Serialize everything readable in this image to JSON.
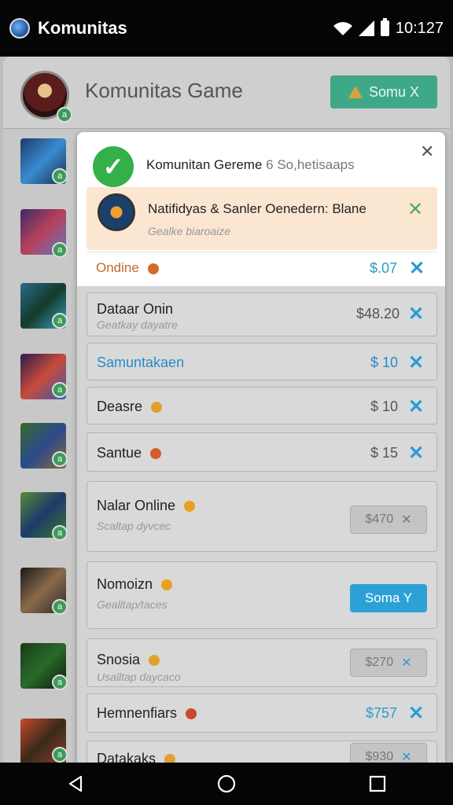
{
  "status_bar": {
    "app_title": "Komunitas",
    "time": "10:127"
  },
  "header": {
    "title": "Komunitas Game",
    "join_label": "Somu X"
  },
  "side_badges": [
    "a",
    "a",
    "a",
    "a",
    "a",
    "a",
    "a",
    "a",
    "a",
    "a"
  ],
  "notification": {
    "title": "Komunitan Gereme",
    "subtitle": "6 So,hetisaaps",
    "inner_title": "Natifidyas & Sanler Oenedern: Blane",
    "inner_sub": "Gealke biaroaize",
    "row_label": "Ondine",
    "row_price": "$.07"
  },
  "items": [
    {
      "name": "Dataar Onin",
      "sub": "Geatkay dayatre",
      "price": "$48.20"
    },
    {
      "name": "Samuntakaen",
      "price": "$ 10"
    },
    {
      "name": "Deasre",
      "price": "$ 10"
    },
    {
      "name": "Santue",
      "price": "$ 15"
    },
    {
      "name": "Nalar Online",
      "sub": "Scaltap dyvcec",
      "button": "$470"
    },
    {
      "name": "Nomoizn",
      "sub": "Gealltap/taces",
      "button": "Soma Y"
    },
    {
      "name": "Snosia",
      "sub": "Usalltap daycaco",
      "button": "$270"
    },
    {
      "name": "Hemnenfiars",
      "price": "$757"
    },
    {
      "name": "Datakaks",
      "button": "$930"
    }
  ],
  "x_glyph": "✕",
  "colors": {
    "accent_blue": "#2a9bd6",
    "success_green": "#34b04a",
    "join_green": "#3fa889"
  }
}
